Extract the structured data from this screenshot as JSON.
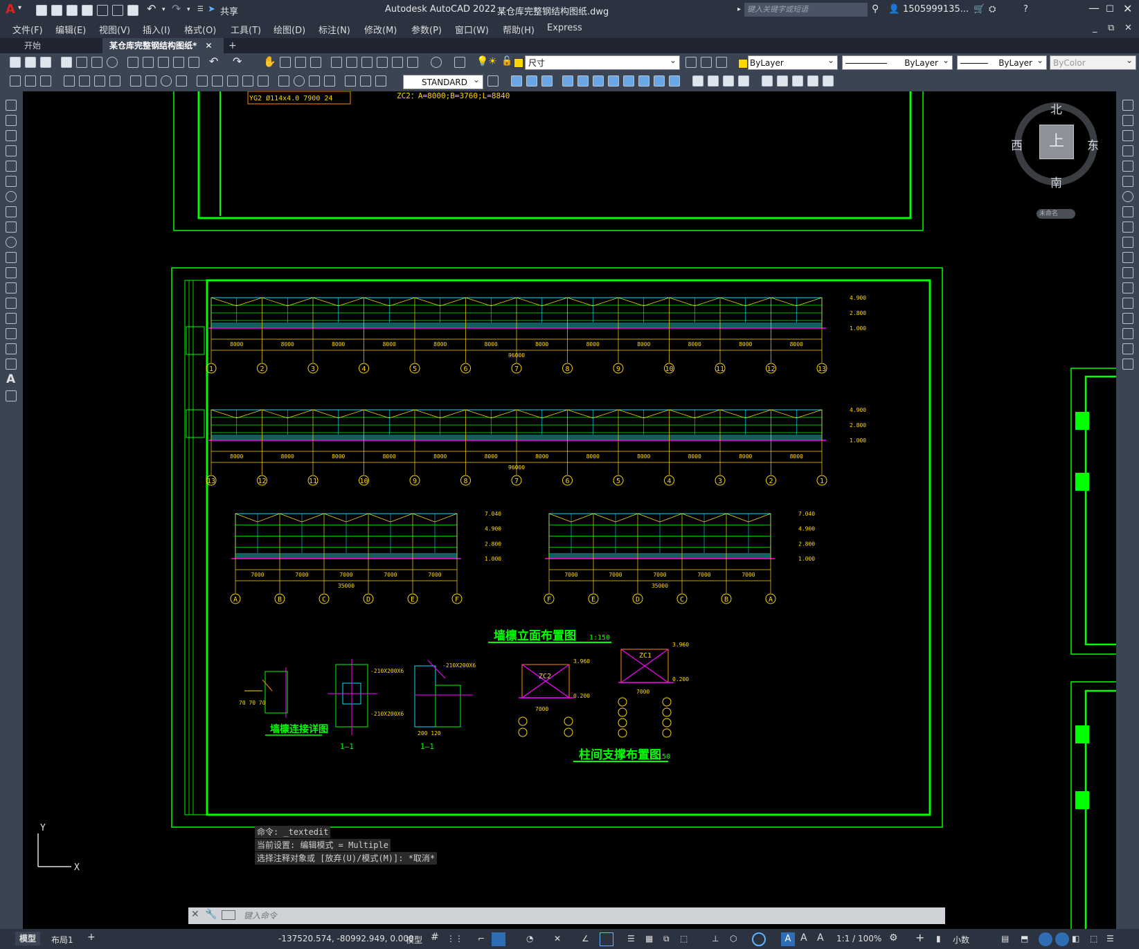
{
  "app": {
    "logo": "A",
    "title": "Autodesk AutoCAD 2022",
    "filename": "某仓库完整钢结构图纸.dwg",
    "share_label": "共享",
    "search_placeholder": "键入关键字或短语",
    "user": "1505999135..."
  },
  "menus": [
    "文件(F)",
    "编辑(E)",
    "视图(V)",
    "插入(I)",
    "格式(O)",
    "工具(T)",
    "绘图(D)",
    "标注(N)",
    "修改(M)",
    "参数(P)",
    "窗口(W)",
    "帮助(H)",
    "Express"
  ],
  "tabs": {
    "start": "开始",
    "current": "某仓库完整钢结构图纸*",
    "new": "+"
  },
  "toolbar": {
    "layer": "尺寸",
    "text_style": "STANDARD",
    "color": "ByLayer",
    "linetype": "ByLayer",
    "lineweight": "ByLayer",
    "plotstyle": "ByColor"
  },
  "viewcube": {
    "north": "北",
    "south": "南",
    "east": "东",
    "west": "西",
    "top": "上",
    "wcs": "未命名"
  },
  "drawing": {
    "top_table_row1": "YG2  Ø114x4.0   7900  24",
    "top_note": "ZC2：A=8000;B=3760;L=8840",
    "title_wall": "墙檩立面布置图",
    "title_wall_scale": "1:150",
    "title_brace": "柱间支撑布置图",
    "title_brace_scale": "1:150",
    "title_detail": "墙檩连接详图",
    "section_label": "1—1",
    "elev_right": [
      "4.900",
      "2.800",
      "1.000"
    ],
    "gable_right": [
      "7.040",
      "4.900",
      "2.800",
      "1.000"
    ],
    "total_long": "96000",
    "total_short": "35000",
    "axes_long": [
      "1",
      "2",
      "3",
      "4",
      "5",
      "6",
      "7",
      "8",
      "9",
      "10",
      "11",
      "12",
      "13"
    ],
    "axes_long_rev": [
      "13",
      "12",
      "11",
      "10",
      "9",
      "8",
      "7",
      "6",
      "5",
      "4",
      "3",
      "2",
      "1"
    ],
    "axes_short": [
      "A",
      "B",
      "C",
      "D",
      "E",
      "F"
    ],
    "axes_short_rev": [
      "F",
      "E",
      "D",
      "C",
      "B",
      "A"
    ],
    "bays_long": [
      "8000",
      "8000",
      "8000",
      "8000",
      "8000",
      "8000",
      "8000",
      "8000",
      "8000",
      "8000",
      "8000",
      "8000"
    ],
    "bays_short": [
      "7000",
      "7000",
      "7000",
      "7000",
      "7000"
    ],
    "zc2": "ZC2",
    "zc1": "ZC1",
    "brace_height_a": "3.960",
    "brace_height_b": "0.200",
    "brace_width": "7000"
  },
  "ucs": {
    "y": "Y",
    "x": "X"
  },
  "command": {
    "history": [
      "命令: _textedit",
      "当前设置: 编辑模式 = Multiple",
      "选择注释对象或 [放弃(U)/模式(M)]: *取消*"
    ],
    "placeholder": "键入命令"
  },
  "layout_tabs": [
    "模型",
    "布局1",
    "+"
  ],
  "status": {
    "coords": "-137520.574, -80992.949, 0.000",
    "space": "模型",
    "scale": "1:1 / 100%",
    "units": "小数"
  },
  "colors": {
    "accent_green": "#00ff00",
    "dim_yellow": "#ffd700",
    "magenta": "#ff00ff",
    "cyan": "#00e5ff",
    "orange": "#ff8c00"
  }
}
